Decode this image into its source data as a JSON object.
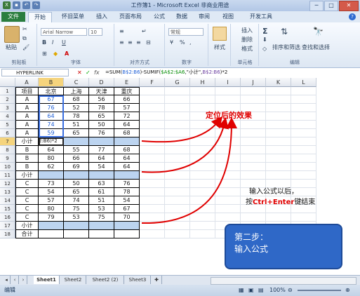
{
  "window": {
    "title": "工作簿1 - Microsoft Excel 非商业用途",
    "qat_icons": [
      "excel-logo-icon",
      "save-icon",
      "undo-icon",
      "redo-icon"
    ],
    "controls": [
      "─",
      "□",
      "✕"
    ]
  },
  "ribbon_tabs": [
    "文件",
    "开始",
    "怀旧菜单",
    "插入",
    "页面布局",
    "公式",
    "数据",
    "审阅",
    "视图",
    "开发工具"
  ],
  "ribbon": {
    "font_name": "Arial Narrow",
    "font_size": "10",
    "number_format": "常规",
    "paste_label": "粘贴",
    "style_label": "样式",
    "sort_label": "排序和筛选",
    "find_label": "查找和选择",
    "insert_label": "插入",
    "delete_label": "删除",
    "format_label": "格式",
    "sigma": "Σ",
    "groups": [
      "剪贴板",
      "字体",
      "对齐方式",
      "数字",
      "单元格",
      "编辑"
    ]
  },
  "formula_bar": {
    "name_box": "HYPERLINK",
    "fx": "fx",
    "formula_parts": [
      "=SUM(",
      "B$2:B6",
      ")-SUMIF(",
      "$A$2:$A6",
      ",\"小计\",",
      "B$2:B6",
      ")*2"
    ]
  },
  "columns": [
    "A",
    "B",
    "C",
    "D",
    "E",
    "F",
    "G",
    "H",
    "I",
    "J",
    "K",
    "L"
  ],
  "rows": [
    "1",
    "2",
    "3",
    "4",
    "5",
    "6",
    "7",
    "8",
    "9",
    "10",
    "11",
    "12",
    "13",
    "14",
    "15",
    "16",
    "17",
    "18"
  ],
  "table": [
    [
      "项目",
      "北京",
      "上海",
      "天津",
      "重庆"
    ],
    [
      "A",
      "67",
      "68",
      "56",
      "66"
    ],
    [
      "A",
      "76",
      "52",
      "78",
      "57"
    ],
    [
      "A",
      "64",
      "78",
      "65",
      "72"
    ],
    [
      "A",
      "74",
      "51",
      "50",
      "64"
    ],
    [
      "A",
      "59",
      "65",
      "76",
      "68"
    ],
    [
      "小计",
      "2:B6)*2",
      "",
      "",
      ""
    ],
    [
      "B",
      "64",
      "55",
      "77",
      "68"
    ],
    [
      "B",
      "80",
      "66",
      "64",
      "64"
    ],
    [
      "B",
      "62",
      "69",
      "54",
      "64"
    ],
    [
      "小计",
      "",
      "",
      "",
      ""
    ],
    [
      "C",
      "73",
      "50",
      "63",
      "76"
    ],
    [
      "C",
      "54",
      "65",
      "61",
      "78"
    ],
    [
      "C",
      "57",
      "74",
      "51",
      "54"
    ],
    [
      "C",
      "80",
      "75",
      "53",
      "67"
    ],
    [
      "C",
      "79",
      "53",
      "75",
      "70"
    ],
    [
      "小计",
      "",
      "",
      "",
      ""
    ],
    [
      "合计",
      "",
      "",
      "",
      ""
    ]
  ],
  "sheet_tabs": [
    "Sheet1",
    "Sheet2",
    "Sheet2 (2)",
    "Sheet3"
  ],
  "status": {
    "mode": "编辑",
    "zoom": "100%"
  },
  "annotations": {
    "result": "定位后的效果",
    "line1": "输入公式以后，",
    "line2_pre": "按",
    "line2_key": "Ctrl+Enter",
    "line2_post": "键结束",
    "step_title": "第二步：",
    "step_text": "输入公式"
  }
}
